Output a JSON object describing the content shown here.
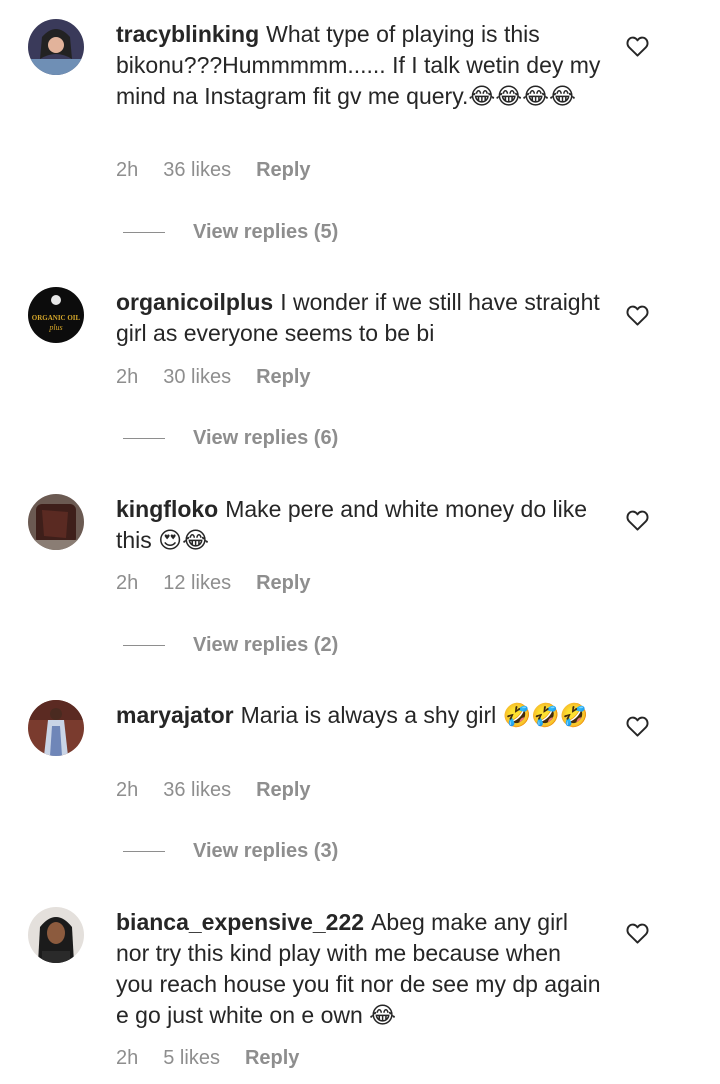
{
  "comments": [
    {
      "username": "tracyblinking",
      "text": "What type of playing is this bikonu???Hummmmm...... If I talk wetin dey my mind na Instagram fit gv me query.😂😂😂😂",
      "time": "2h",
      "likes": "36 likes",
      "reply": "Reply",
      "view_replies": "View replies (5)"
    },
    {
      "username": "organicoilplus",
      "text": "I wonder if we still have straight girl as everyone seems to be bi",
      "time": "2h",
      "likes": "30 likes",
      "reply": "Reply",
      "view_replies": "View replies (6)",
      "avatar_logo_text": "ORGANIC OIL plus"
    },
    {
      "username": "kingfloko",
      "text": "Make pere and white money do like this 😍😂",
      "time": "2h",
      "likes": "12 likes",
      "reply": "Reply",
      "view_replies": "View replies (2)"
    },
    {
      "username": "maryajator",
      "text": "Maria is always a shy girl 🤣🤣🤣",
      "time": "2h",
      "likes": "36 likes",
      "reply": "Reply",
      "view_replies": "View replies (3)"
    },
    {
      "username": "bianca_expensive_222",
      "text": "Abeg make any girl nor try this kind play with me because when you reach house you fit nor de see my dp again e go just white on e own 😂",
      "time": "2h",
      "likes": "5 likes",
      "reply": "Reply"
    }
  ],
  "icons": {
    "like": "heart-outline-icon",
    "line": "reply-thread-line"
  },
  "colors": {
    "text": "#262626",
    "muted": "#8e8e8e",
    "background": "#ffffff"
  }
}
